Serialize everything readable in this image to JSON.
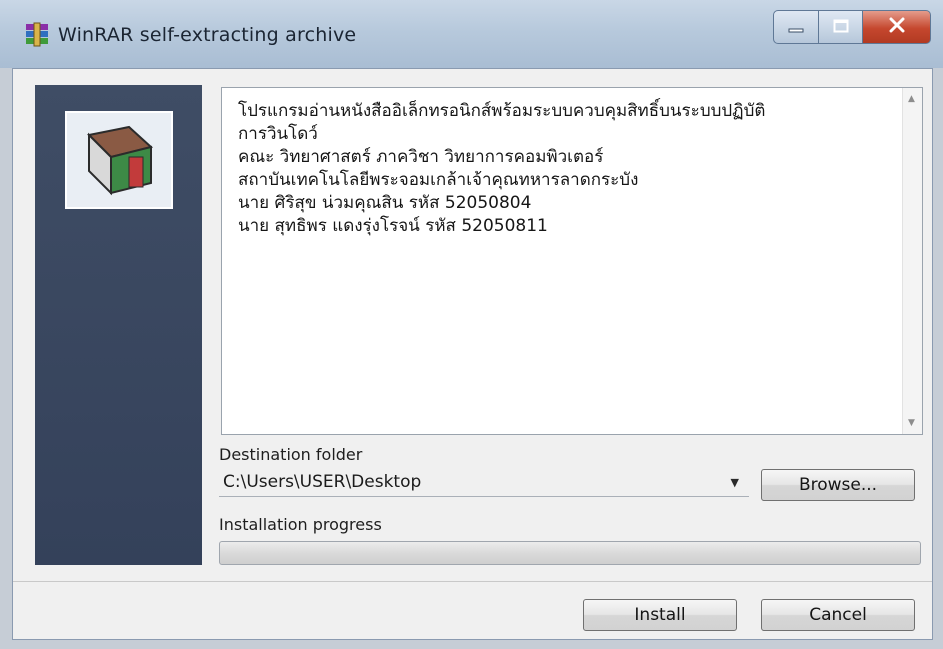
{
  "window": {
    "title": "WinRAR self-extracting archive"
  },
  "info_lines": [
    "โปรแกรมอ่านหนังสืออิเล็กทรอนิกส์พร้อมระบบควบคุมสิทธิ์บนระบบปฏิบัติ",
    "การวินโดว์",
    "คณะ วิทยาศาสตร์   ภาควิชา วิทยาการคอมพิวเตอร์",
    "สถาบันเทคโนโลยีพระจอมเกล้าเจ้าคุณทหารลาดกระบัง",
    "นาย ศิริสุข น่วมคุณสิน รหัส 52050804",
    "นาย สุทธิพร แดงรุ่งโรจน์ รหัส 52050811"
  ],
  "destination": {
    "label": "Destination folder",
    "value": "C:\\Users\\USER\\Desktop"
  },
  "browse_label": "Browse...",
  "progress": {
    "label": "Installation progress",
    "percent": 0
  },
  "install_label": "Install",
  "cancel_label": "Cancel",
  "icons": [
    "winrar-archive-icon",
    "minimize-icon",
    "maximize-icon",
    "close-icon",
    "archive-box-icon",
    "scroll-up-arrow-icon",
    "scroll-down-arrow-icon",
    "chevron-down-icon"
  ],
  "colors": {
    "side_panel": "#3a475f",
    "close_button": "#c5472e",
    "progress_fill": "#37b24a"
  }
}
